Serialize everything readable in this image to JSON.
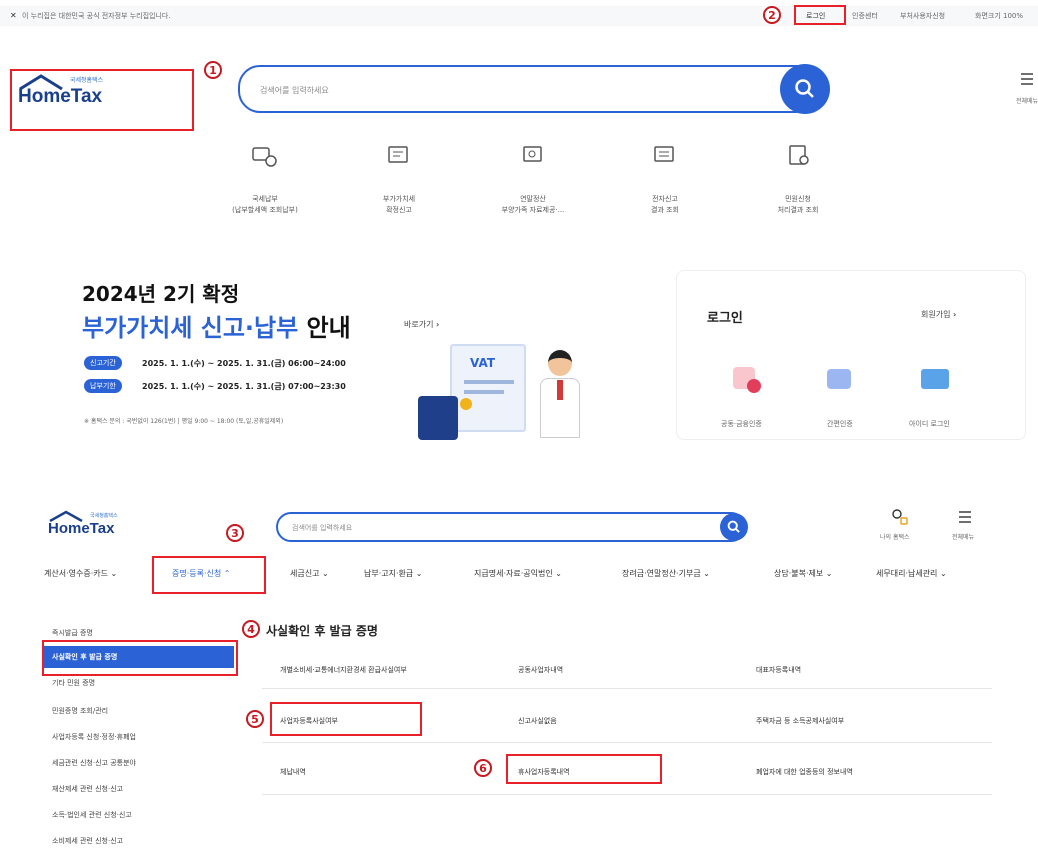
{
  "gov_notice": "이 누리집은 대한민국 공식 전자정부 누리집입니다.",
  "top_links": [
    "로그인",
    "인증센터",
    "부처사용자신청",
    "화면크기 100%"
  ],
  "logo": {
    "sub": "국세청홈택스",
    "name": "HomeTax"
  },
  "search_placeholder": "검색어를 입력하세요",
  "all_menu_label": "전체메뉴",
  "quick_menu": [
    {
      "label": "국세납부",
      "sub": "(납부할세액 조회납부)"
    },
    {
      "label": "부가가치세",
      "sub": "확정신고"
    },
    {
      "label": "연말정산",
      "sub": "부양가족 자료제공·..."
    },
    {
      "label": "전자신고",
      "sub": "결과 조회"
    },
    {
      "label": "민원신청",
      "sub": "처리결과 조회"
    }
  ],
  "banner": {
    "line1": "2024년 2기 확정",
    "line2_blue": "부가가치세 신고·납부",
    "line2_black": " 안내",
    "more": "바로가기",
    "badge1": "신고기간",
    "date1": "2025. 1. 1.(수) ~ 2025. 1. 31.(금) 06:00~24:00",
    "badge2": "납부기한",
    "date2": "2025. 1. 1.(수) ~ 2025. 1. 31.(금) 07:00~23:30",
    "note": "※ 홈택스 문의 : 국번없이 126(1번) | 평일 9:00 ~ 18:00 (토,일,공휴일제외)",
    "vat": "VAT"
  },
  "login_panel": {
    "title": "로그인",
    "signup": "회원가입",
    "options": [
      "공동·금융인증",
      "간편인증",
      "아이디 로그인"
    ]
  },
  "header2": {
    "my_hometax": "나의 홈택스",
    "all_menu": "전체메뉴",
    "nav": [
      "계산서·영수증·카드",
      "증명·등록·신청",
      "세금신고",
      "납부·고지·환급",
      "지급명세·자료·공익법인",
      "장려금·연말정산·기부금",
      "상담·불복·제보",
      "세무대리·납세관리"
    ]
  },
  "sidebar": [
    "즉시발급 증명",
    "사실확인 후 발급 증명",
    "기타 민원 증명",
    "민원증명 조회/관리",
    "사업자등록 신청·정정·휴폐업",
    "세금관련 신청·신고 공통분야",
    "재산제세 관련 신청·신고",
    "소득·법인세 관련 신청·신고",
    "소비제세 관련 신청·신고"
  ],
  "section_title": "사실확인 후 발급 증명",
  "grid": [
    [
      "개별소비세·교통에너지환경세 환급사실여부",
      "공동사업자내역",
      "대표자등록내역"
    ],
    [
      "사업자등록사실여부",
      "신고사실없음",
      "주택자금 등 소득공제사실여부"
    ],
    [
      "체납내역",
      "휴사업자등록내역",
      "폐업자에 대한 업종등의 정보내역"
    ]
  ],
  "markers": [
    "1",
    "2",
    "3",
    "4",
    "5",
    "6"
  ],
  "colors": {
    "accent": "#2b63d6",
    "highlight": "#e8202a",
    "logo": "#1a3f8c"
  }
}
